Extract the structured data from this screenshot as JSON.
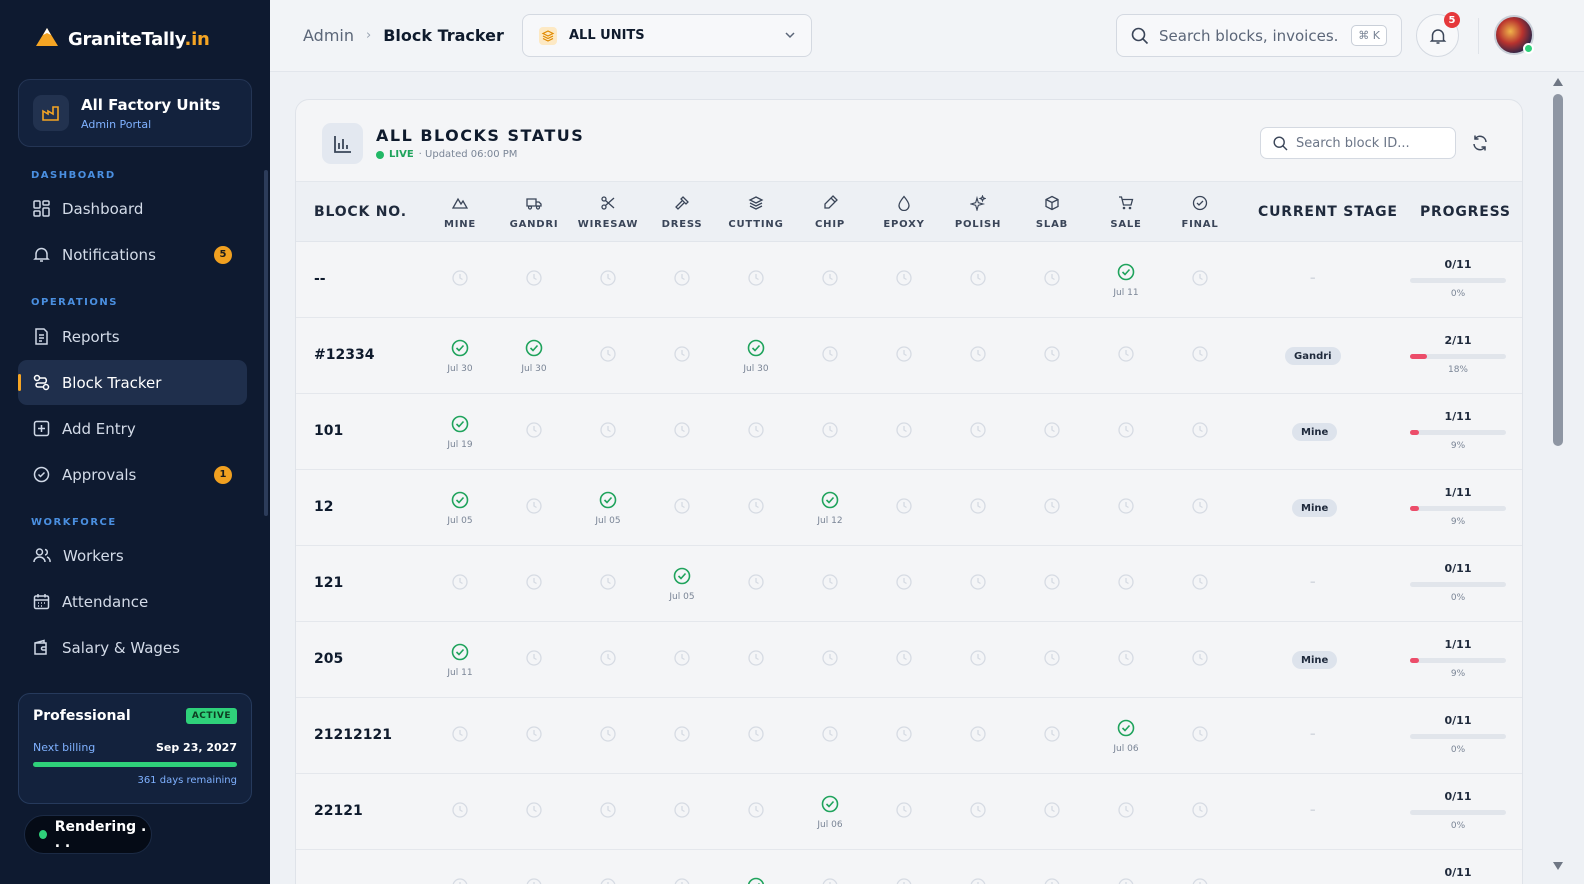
{
  "brand": {
    "name": "GraniteTally",
    "tld": ".in"
  },
  "unit_card": {
    "title": "All Factory Units",
    "subtitle": "Admin Portal"
  },
  "sidebar": {
    "sections": [
      {
        "label": "DASHBOARD"
      },
      {
        "label": "OPERATIONS"
      },
      {
        "label": "WORKFORCE"
      }
    ],
    "items": [
      {
        "label": "Dashboard",
        "icon": "grid-icon"
      },
      {
        "label": "Notifications",
        "icon": "bell-icon",
        "badge": "5"
      },
      {
        "label": "Reports",
        "icon": "document-icon"
      },
      {
        "label": "Block Tracker",
        "icon": "route-icon",
        "active": true
      },
      {
        "label": "Add Entry",
        "icon": "plus-square-icon"
      },
      {
        "label": "Approvals",
        "icon": "check-circle-icon",
        "badge": "1"
      },
      {
        "label": "Workers",
        "icon": "users-icon"
      },
      {
        "label": "Attendance",
        "icon": "calendar-icon"
      },
      {
        "label": "Salary & Wages",
        "icon": "wallet-icon"
      }
    ]
  },
  "plan": {
    "name": "Professional",
    "status": "ACTIVE",
    "billing_label": "Next billing",
    "billing_date": "Sep 23, 2027",
    "remaining": "361 days remaining"
  },
  "render_status": "Rendering . . .",
  "breadcrumb": {
    "parent": "Admin",
    "current": "Block Tracker"
  },
  "unit_select": {
    "value": "ALL UNITS"
  },
  "top_search": {
    "placeholder": "Search blocks, invoices...",
    "shortcut": "⌘ K"
  },
  "notifications_count": "5",
  "panel": {
    "title": "ALL BLOCKS STATUS",
    "live": "LIVE",
    "updated": "· Updated 06:00 PM",
    "search_placeholder": "Search block ID..."
  },
  "table": {
    "block_header": "BLOCK NO.",
    "stage_header": "CURRENT STAGE",
    "progress_header": "PROGRESS",
    "stages": [
      {
        "label": "MINE",
        "icon": "mountain-icon"
      },
      {
        "label": "GANDRI",
        "icon": "truck-icon"
      },
      {
        "label": "WIRESAW",
        "icon": "scissors-icon"
      },
      {
        "label": "DRESS",
        "icon": "hammer-icon"
      },
      {
        "label": "CUTTING",
        "icon": "layers-icon"
      },
      {
        "label": "CHIP",
        "icon": "chisel-icon"
      },
      {
        "label": "EPOXY",
        "icon": "droplet-icon"
      },
      {
        "label": "POLISH",
        "icon": "sparkles-icon"
      },
      {
        "label": "SLAB",
        "icon": "box-icon"
      },
      {
        "label": "SALE",
        "icon": "cart-icon"
      },
      {
        "label": "FINAL",
        "icon": "check-badge-icon"
      }
    ],
    "rows": [
      {
        "block": "--",
        "done": {
          "9": "Jul 11"
        },
        "stage": "",
        "count": "0/11",
        "pct": "0%",
        "fraction": 0
      },
      {
        "block": "#12334",
        "done": {
          "0": "Jul 30",
          "1": "Jul 30",
          "4": "Jul 30"
        },
        "stage": "Gandri",
        "count": "2/11",
        "pct": "18%",
        "fraction": 0.18
      },
      {
        "block": "101",
        "done": {
          "0": "Jul 19"
        },
        "stage": "Mine",
        "count": "1/11",
        "pct": "9%",
        "fraction": 0.09
      },
      {
        "block": "12",
        "done": {
          "0": "Jul 05",
          "2": "Jul 05",
          "5": "Jul 12"
        },
        "stage": "Mine",
        "count": "1/11",
        "pct": "9%",
        "fraction": 0.09
      },
      {
        "block": "121",
        "done": {
          "3": "Jul 05"
        },
        "stage": "",
        "count": "0/11",
        "pct": "0%",
        "fraction": 0
      },
      {
        "block": "205",
        "done": {
          "0": "Jul 11"
        },
        "stage": "Mine",
        "count": "1/11",
        "pct": "9%",
        "fraction": 0.09
      },
      {
        "block": "21212121",
        "done": {
          "9": "Jul 06"
        },
        "stage": "",
        "count": "0/11",
        "pct": "0%",
        "fraction": 0
      },
      {
        "block": "22121",
        "done": {
          "5": "Jul 06"
        },
        "stage": "",
        "count": "0/11",
        "pct": "0%",
        "fraction": 0
      },
      {
        "block": "",
        "done": {
          "4": ""
        },
        "stage": "",
        "count": "0/11",
        "pct": "",
        "fraction": 0
      }
    ],
    "empty_stage": "–"
  },
  "colors": {
    "accent": "#f5a524",
    "success": "#1fa35c",
    "progress": "#ec4d6a",
    "sidebar": "#0e1a30"
  }
}
